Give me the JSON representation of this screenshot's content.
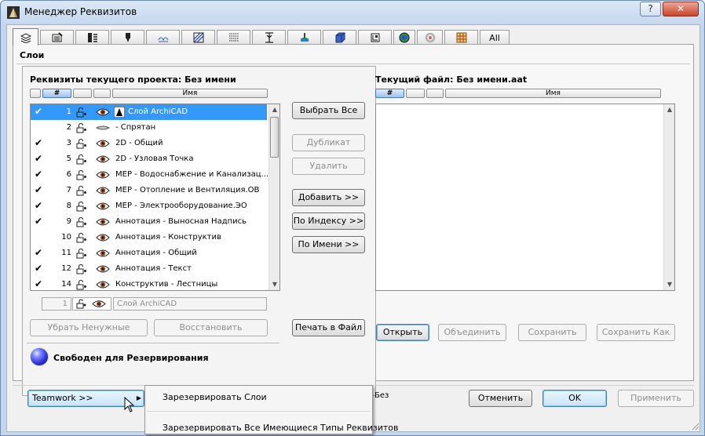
{
  "window": {
    "title": "Менеджер Реквизитов",
    "help_label": "?",
    "close_label": "✕"
  },
  "tabs": [
    {
      "icon": "layers-icon",
      "active": true
    },
    {
      "icon": "pens-icon"
    },
    {
      "icon": "line-types-icon"
    },
    {
      "icon": "fill-icon"
    },
    {
      "icon": "composites-icon"
    },
    {
      "icon": "profiles-icon"
    },
    {
      "icon": "surfaces-icon"
    },
    {
      "icon": "zones-icon"
    },
    {
      "icon": "mep-systems-icon"
    },
    {
      "icon": "building-materials-icon"
    },
    {
      "icon": "markup-styles-icon"
    },
    {
      "icon": "operation-profiles-icon"
    },
    {
      "icon": "renovation-icon"
    },
    {
      "icon": "model-views-icon"
    },
    {
      "label": "All"
    }
  ],
  "page": {
    "title": "Слои"
  },
  "left": {
    "title": "Реквизиты текущего проекта: Без имени",
    "headers": {
      "num": "#",
      "name": "Имя"
    },
    "rows": [
      {
        "check": "✔",
        "num": "1",
        "name": "Слой ArchiCAD",
        "selected": true
      },
      {
        "check": "",
        "num": "2",
        "name": "- Спрятан",
        "hidden": true
      },
      {
        "check": "✔",
        "num": "3",
        "name": "2D - Общий"
      },
      {
        "check": "✔",
        "num": "5",
        "name": "2D - Узловая Точка"
      },
      {
        "check": "✔",
        "num": "6",
        "name": "MEP - Водоснабжение и Канализац..."
      },
      {
        "check": "✔",
        "num": "7",
        "name": "MEP - Отопление и Вентиляция.ОВ"
      },
      {
        "check": "✔",
        "num": "8",
        "name": "MEP - Электрооборудование.ЭО"
      },
      {
        "check": "✔",
        "num": "9",
        "name": "Аннотация - Выносная Надпись"
      },
      {
        "check": "",
        "num": "10",
        "name": "Аннотация - Конструктив"
      },
      {
        "check": "✔",
        "num": "11",
        "name": "Аннотация - Общий"
      },
      {
        "check": "✔",
        "num": "12",
        "name": "Аннотация - Текст"
      },
      {
        "check": "✔",
        "num": "14",
        "name": "Конструктив - Лестницы"
      }
    ],
    "edit_num": "1",
    "edit_name": "Слой ArchiCAD",
    "btn_remove_unused": "Убрать Ненужные",
    "btn_restore": "Восстановить",
    "status_text": "Свободен для Резервирования"
  },
  "middle": {
    "select_all": "Выбрать Все",
    "duplicate": "Дубликат",
    "delete": "Удалить",
    "add": "Добавить >>",
    "by_index": "По Индексу >>",
    "by_name": "По Имени >>",
    "print_to_file": "Печать в Файл"
  },
  "right": {
    "title": "Текущий файл: Без имени.aat",
    "headers": {
      "num": "#",
      "name": "Имя"
    },
    "open": "Открыть",
    "merge": "Объединить",
    "save": "Сохранить",
    "save_as": "Сохранить Как"
  },
  "footer": {
    "teamwork": "Teamwork >>",
    "partial_text": "Без",
    "cancel": "Отменить",
    "ok": "OK",
    "apply": "Применить"
  },
  "menu": {
    "item1": "Зарезервировать Слои",
    "item2": "Зарезервировать Все Имеющиеся Типы Реквизитов"
  },
  "colors": {
    "selection": "#3399ff",
    "accent": "#2d33d6"
  }
}
